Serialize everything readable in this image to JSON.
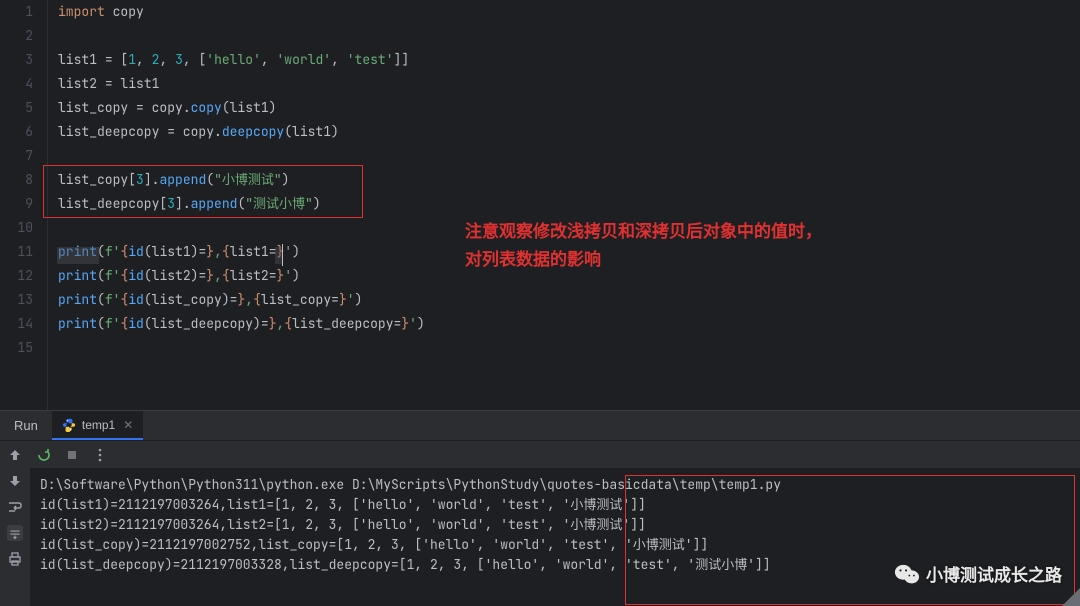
{
  "gutter": {
    "start": 1,
    "end": 15
  },
  "code": [
    {
      "tokens": [
        {
          "c": "kw",
          "t": "import"
        },
        {
          "c": "op",
          "t": " copy"
        }
      ]
    },
    {
      "tokens": []
    },
    {
      "tokens": [
        {
          "c": "ident",
          "t": "list1 "
        },
        {
          "c": "op",
          "t": "= ["
        },
        {
          "c": "num",
          "t": "1"
        },
        {
          "c": "op",
          "t": ", "
        },
        {
          "c": "num",
          "t": "2"
        },
        {
          "c": "op",
          "t": ", "
        },
        {
          "c": "num",
          "t": "3"
        },
        {
          "c": "op",
          "t": ", ["
        },
        {
          "c": "str",
          "t": "'hello'"
        },
        {
          "c": "op",
          "t": ", "
        },
        {
          "c": "str",
          "t": "'world'"
        },
        {
          "c": "op",
          "t": ", "
        },
        {
          "c": "str",
          "t": "'test'"
        },
        {
          "c": "op",
          "t": "]]"
        }
      ]
    },
    {
      "tokens": [
        {
          "c": "ident",
          "t": "list2 "
        },
        {
          "c": "op",
          "t": "= list1"
        }
      ]
    },
    {
      "tokens": [
        {
          "c": "ident",
          "t": "list_copy "
        },
        {
          "c": "op",
          "t": "= copy."
        },
        {
          "c": "fn",
          "t": "copy"
        },
        {
          "c": "op",
          "t": "(list1)"
        }
      ]
    },
    {
      "tokens": [
        {
          "c": "ident",
          "t": "list_deepcopy "
        },
        {
          "c": "op",
          "t": "= copy."
        },
        {
          "c": "fn",
          "t": "deepcopy"
        },
        {
          "c": "op",
          "t": "(list1)"
        }
      ]
    },
    {
      "tokens": []
    },
    {
      "tokens": [
        {
          "c": "ident",
          "t": "list_copy["
        },
        {
          "c": "num",
          "t": "3"
        },
        {
          "c": "ident",
          "t": "]."
        },
        {
          "c": "fn",
          "t": "append"
        },
        {
          "c": "op",
          "t": "("
        },
        {
          "c": "str",
          "t": "\"小博测试\""
        },
        {
          "c": "op",
          "t": ")"
        }
      ]
    },
    {
      "tokens": [
        {
          "c": "ident",
          "t": "list_deepcopy["
        },
        {
          "c": "num",
          "t": "3"
        },
        {
          "c": "ident",
          "t": "]."
        },
        {
          "c": "fn",
          "t": "append"
        },
        {
          "c": "op",
          "t": "("
        },
        {
          "c": "str",
          "t": "\"测试小博\""
        },
        {
          "c": "op",
          "t": ")"
        }
      ]
    },
    {
      "tokens": []
    },
    {
      "tokens": [
        {
          "c": "fn",
          "t": "print"
        },
        {
          "c": "op",
          "t": "("
        },
        {
          "c": "str",
          "t": "f'"
        },
        {
          "c": "fbrace",
          "t": "{"
        },
        {
          "c": "fn",
          "t": "id"
        },
        {
          "c": "ident",
          "t": "(list1)"
        },
        {
          "c": "op",
          "t": "="
        },
        {
          "c": "fbrace",
          "t": "}"
        },
        {
          "c": "str",
          "t": ","
        },
        {
          "c": "fbrace",
          "t": "{"
        },
        {
          "c": "ident",
          "t": "list1"
        },
        {
          "c": "op",
          "t": "="
        },
        {
          "c": "fbrace",
          "t": "}"
        },
        {
          "c": "str",
          "t": "'"
        },
        {
          "c": "op",
          "t": ")"
        }
      ]
    },
    {
      "tokens": [
        {
          "c": "fn",
          "t": "print"
        },
        {
          "c": "op",
          "t": "("
        },
        {
          "c": "str",
          "t": "f'"
        },
        {
          "c": "fbrace",
          "t": "{"
        },
        {
          "c": "fn",
          "t": "id"
        },
        {
          "c": "ident",
          "t": "(list2)"
        },
        {
          "c": "op",
          "t": "="
        },
        {
          "c": "fbrace",
          "t": "}"
        },
        {
          "c": "str",
          "t": ","
        },
        {
          "c": "fbrace",
          "t": "{"
        },
        {
          "c": "ident",
          "t": "list2"
        },
        {
          "c": "op",
          "t": "="
        },
        {
          "c": "fbrace",
          "t": "}"
        },
        {
          "c": "str",
          "t": "'"
        },
        {
          "c": "op",
          "t": ")"
        }
      ]
    },
    {
      "tokens": [
        {
          "c": "fn",
          "t": "print"
        },
        {
          "c": "op",
          "t": "("
        },
        {
          "c": "str",
          "t": "f'"
        },
        {
          "c": "fbrace",
          "t": "{"
        },
        {
          "c": "fn",
          "t": "id"
        },
        {
          "c": "ident",
          "t": "(list_copy)"
        },
        {
          "c": "op",
          "t": "="
        },
        {
          "c": "fbrace",
          "t": "}"
        },
        {
          "c": "str",
          "t": ","
        },
        {
          "c": "fbrace",
          "t": "{"
        },
        {
          "c": "ident",
          "t": "list_copy"
        },
        {
          "c": "op",
          "t": "="
        },
        {
          "c": "fbrace",
          "t": "}"
        },
        {
          "c": "str",
          "t": "'"
        },
        {
          "c": "op",
          "t": ")"
        }
      ]
    },
    {
      "tokens": [
        {
          "c": "fn",
          "t": "print"
        },
        {
          "c": "op",
          "t": "("
        },
        {
          "c": "str",
          "t": "f'"
        },
        {
          "c": "fbrace",
          "t": "{"
        },
        {
          "c": "fn",
          "t": "id"
        },
        {
          "c": "ident",
          "t": "(list_deepcopy)"
        },
        {
          "c": "op",
          "t": "="
        },
        {
          "c": "fbrace",
          "t": "}"
        },
        {
          "c": "str",
          "t": ","
        },
        {
          "c": "fbrace",
          "t": "{"
        },
        {
          "c": "ident",
          "t": "list_deepcopy"
        },
        {
          "c": "op",
          "t": "="
        },
        {
          "c": "fbrace",
          "t": "}"
        },
        {
          "c": "str",
          "t": "'"
        },
        {
          "c": "op",
          "t": ")"
        }
      ]
    },
    {
      "tokens": []
    }
  ],
  "annotation": {
    "line1": "注意观察修改浅拷贝和深拷贝后对象中的值时，",
    "line2": "对列表数据的影响"
  },
  "run": {
    "label": "Run",
    "tab_name": "temp1",
    "output": [
      "D:\\Software\\Python\\Python311\\python.exe D:\\MyScripts\\PythonStudy\\quotes-basicdata\\temp\\temp1.py",
      "id(list1)=2112197003264,list1=[1, 2, 3, ['hello', 'world', 'test', '小博测试']]",
      "id(list2)=2112197003264,list2=[1, 2, 3, ['hello', 'world', 'test', '小博测试']]",
      "id(list_copy)=2112197002752,list_copy=[1, 2, 3, ['hello', 'world', 'test', '小博测试']]",
      "id(list_deepcopy)=2112197003328,list_deepcopy=[1, 2, 3, ['hello', 'world', 'test', '测试小博']]"
    ]
  },
  "watermark": "小博测试成长之路"
}
